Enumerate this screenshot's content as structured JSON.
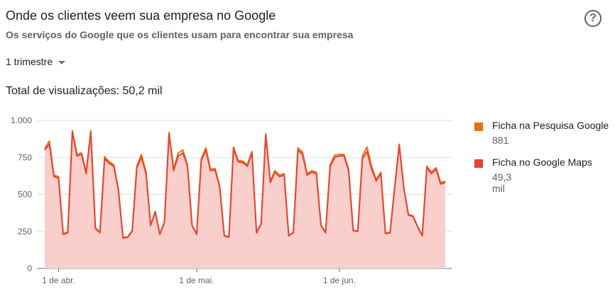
{
  "header": {
    "title": "Onde os clientes veem sua empresa no Google",
    "subtitle": "Os serviços do Google que os clientes usam para encontrar sua empresa",
    "help_icon": "help-circle-icon",
    "help_glyph": "?"
  },
  "period_selector": {
    "value": "1 trimestre",
    "icon": "dropdown-caret-icon"
  },
  "total": "Total de visualizações: 50,2 mil",
  "legend": [
    {
      "name": "Ficha na Pesquisa Google",
      "value": "881",
      "color": "#e8710a"
    },
    {
      "name": "Ficha no Google Maps",
      "value": "49,3 mil",
      "color": "#e94235"
    }
  ],
  "chart_data": {
    "type": "area",
    "ylim": [
      0,
      1000
    ],
    "y_ticks": [
      0,
      250,
      500,
      750,
      1000
    ],
    "y_tick_labels": [
      "0",
      "250",
      "500",
      "750",
      "1.000"
    ],
    "x_ticks": [
      {
        "index": 3,
        "label": "1 de abr."
      },
      {
        "index": 33,
        "label": "1 de mai."
      },
      {
        "index": 64,
        "label": "1 de jun."
      }
    ],
    "fill_color": "#f9cfcb",
    "series": [
      {
        "name": "Ficha no Google Maps",
        "color": "#e94235",
        "values": [
          800,
          840,
          620,
          610,
          230,
          240,
          920,
          760,
          770,
          640,
          920,
          270,
          240,
          740,
          710,
          690,
          530,
          205,
          210,
          250,
          680,
          750,
          640,
          290,
          380,
          230,
          310,
          910,
          660,
          760,
          780,
          690,
          290,
          230,
          730,
          800,
          660,
          665,
          550,
          220,
          210,
          810,
          720,
          715,
          690,
          780,
          240,
          300,
          900,
          580,
          650,
          620,
          630,
          220,
          240,
          800,
          770,
          630,
          650,
          640,
          290,
          240,
          690,
          750,
          760,
          760,
          660,
          255,
          250,
          740,
          790,
          670,
          590,
          640,
          235,
          240,
          540,
          830,
          540,
          360,
          350,
          280,
          220,
          680,
          640,
          670,
          570,
          580
        ]
      },
      {
        "name": "Ficha na Pesquisa Google",
        "color": "#e8710a",
        "values": [
          810,
          860,
          630,
          620,
          235,
          245,
          930,
          770,
          780,
          650,
          930,
          275,
          245,
          755,
          720,
          700,
          535,
          208,
          213,
          255,
          690,
          770,
          650,
          293,
          385,
          233,
          315,
          920,
          670,
          780,
          800,
          700,
          293,
          233,
          740,
          815,
          670,
          675,
          555,
          223,
          213,
          820,
          730,
          725,
          700,
          790,
          243,
          303,
          910,
          590,
          660,
          630,
          640,
          223,
          243,
          815,
          785,
          640,
          660,
          650,
          293,
          243,
          700,
          765,
          770,
          770,
          670,
          258,
          253,
          760,
          820,
          690,
          600,
          650,
          238,
          243,
          545,
          840,
          545,
          365,
          355,
          283,
          223,
          690,
          650,
          680,
          580,
          590
        ]
      }
    ]
  }
}
